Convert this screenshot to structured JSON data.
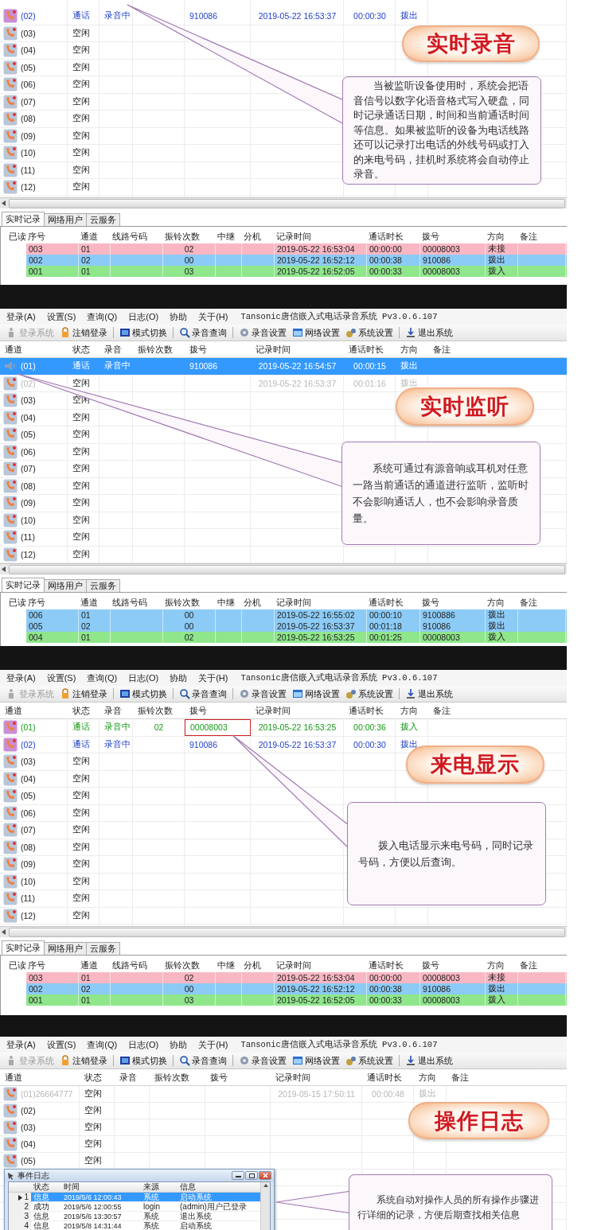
{
  "panels": [
    {
      "rows": [
        {
          "channel": "(02)",
          "in_call": true,
          "status": "通话",
          "recording": "录音中",
          "dial": "910086",
          "time": "2019-05-22 16:53:37",
          "duration": "00:00:30",
          "direction": "拨出",
          "color": "#1f3fc8",
          "selected": false
        },
        {
          "channel": "(03)",
          "in_call": false,
          "status": "空闲",
          "selected": false
        },
        {
          "channel": "(04)",
          "in_call": false,
          "status": "空闲",
          "selected": false
        },
        {
          "channel": "(05)",
          "in_call": false,
          "status": "空闲",
          "selected": false
        },
        {
          "channel": "(06)",
          "in_call": false,
          "status": "空闲",
          "selected": false
        },
        {
          "channel": "(07)",
          "in_call": false,
          "status": "空闲",
          "selected": false
        },
        {
          "channel": "(08)",
          "in_call": false,
          "status": "空闲",
          "selected": false
        },
        {
          "channel": "(09)",
          "in_call": false,
          "status": "空闲",
          "selected": false
        },
        {
          "channel": "(10)",
          "in_call": false,
          "status": "空闲",
          "selected": false
        },
        {
          "channel": "(11)",
          "in_call": false,
          "status": "空闲",
          "selected": false
        },
        {
          "channel": "(12)",
          "in_call": false,
          "status": "空闲",
          "selected": false
        }
      ],
      "badge": "实时录音",
      "callout": "当被监听设备使用时，系统会把语音信号以数字化语音格式写入硬盘，同时记录通话日期，时间和当前通话时间等信息。如果被监听的设备为电话线路还可以记录打出电话的外线号码或打入的来电号码，挂机时系统将会自动停止录音。",
      "bottom_tabs": [
        {
          "label": "实时记录",
          "selected": true
        },
        {
          "label": "网络用户",
          "selected": false
        },
        {
          "label": "云服务",
          "selected": false
        }
      ],
      "log": {
        "columns": [
          "已读",
          "序号",
          "通道",
          "线路号码",
          "振铃次数",
          "中继",
          "分机",
          "记录时间",
          "通话时长",
          "拨号",
          "方向",
          "备注"
        ],
        "rows": [
          {
            "seq": "003",
            "channel": "01",
            "rings": "02",
            "time": "2019-05-22 16:53:04",
            "duration": "00:00:00",
            "dial": "00008003",
            "direction": "未接",
            "color": "#f9b7c4"
          },
          {
            "seq": "002",
            "channel": "02",
            "rings": "00",
            "time": "2019-05-22 16:52:12",
            "duration": "00:00:38",
            "dial": "910086",
            "direction": "拨出",
            "color": "#8ccbf6"
          },
          {
            "seq": "001",
            "channel": "01",
            "rings": "03",
            "time": "2019-05-22 16:52:05",
            "duration": "00:00:33",
            "dial": "00008003",
            "direction": "拨入",
            "color": "#8fe68b"
          }
        ]
      }
    },
    {
      "menu": {
        "items": [
          "登录(A)",
          "设置(S)",
          "查询(Q)",
          "日志(O)",
          "协助",
          "关于(H)"
        ],
        "title": "Tansonic唐信嵌入式电话录音系统 Pv3.0.6.107"
      },
      "toolbar": [
        {
          "label": "登录系统",
          "disabled": true
        },
        {
          "label": "注销登录",
          "disabled": false
        },
        {
          "label": "模式切换",
          "disabled": false
        },
        {
          "label": "录音查询",
          "disabled": false
        },
        {
          "label": "录音设置",
          "disabled": false
        },
        {
          "label": "网络设置",
          "disabled": false
        },
        {
          "label": "系统设置",
          "disabled": false
        },
        {
          "label": "退出系统",
          "disabled": false
        }
      ],
      "columns": [
        "通道",
        "状态",
        "录音",
        "振铃次数",
        "拨号",
        "记录时间",
        "通话时长",
        "方向",
        "备注"
      ],
      "rows": [
        {
          "channel": "(01)",
          "in_call": true,
          "monitoring": true,
          "status": "通话",
          "recording": "录音中",
          "dial": "910086",
          "time": "2019-05-22 16:54:57",
          "duration": "00:00:15",
          "direction": "拨出",
          "selected": true
        },
        {
          "channel": "(02)",
          "in_call": false,
          "monitoring": false,
          "status": "空闲",
          "time": "2019-05-22 16:53:37",
          "duration": "00:01:16",
          "direction": "拨出",
          "color": "#b8b8b8",
          "selected": false
        },
        {
          "channel": "(03)",
          "in_call": false,
          "monitoring": false,
          "status": "空闲",
          "selected": false
        },
        {
          "channel": "(04)",
          "in_call": false,
          "monitoring": false,
          "status": "空闲",
          "selected": false
        },
        {
          "channel": "(05)",
          "in_call": false,
          "monitoring": false,
          "status": "空闲",
          "selected": false
        },
        {
          "channel": "(06)",
          "in_call": false,
          "monitoring": false,
          "status": "空闲",
          "selected": false
        },
        {
          "channel": "(07)",
          "in_call": false,
          "monitoring": false,
          "status": "空闲",
          "selected": false
        },
        {
          "channel": "(08)",
          "in_call": false,
          "monitoring": false,
          "status": "空闲",
          "selected": false
        },
        {
          "channel": "(09)",
          "in_call": false,
          "monitoring": false,
          "status": "空闲",
          "selected": false
        },
        {
          "channel": "(10)",
          "in_call": false,
          "monitoring": false,
          "status": "空闲",
          "selected": false
        },
        {
          "channel": "(11)",
          "in_call": false,
          "monitoring": false,
          "status": "空闲",
          "selected": false
        },
        {
          "channel": "(12)",
          "in_call": false,
          "monitoring": false,
          "status": "空闲",
          "selected": false
        }
      ],
      "badge": "实时监听",
      "callout": "系统可通过有源音响或耳机对任意一路当前通话的通道进行监听，监听时不会影响通话人，也不会影响录音质量。",
      "bottom_tabs": [
        {
          "label": "实时记录",
          "selected": true
        },
        {
          "label": "网络用户",
          "selected": false
        },
        {
          "label": "云服务",
          "selected": false
        }
      ],
      "log": {
        "columns": [
          "已读",
          "序号",
          "通道",
          "线路号码",
          "振铃次数",
          "中继",
          "分机",
          "记录时间",
          "通话时长",
          "拨号",
          "方向",
          "备注"
        ],
        "rows": [
          {
            "seq": "006",
            "channel": "01",
            "rings": "00",
            "time": "2019-05-22 16:55:02",
            "duration": "00:00:10",
            "dial": "9100886",
            "direction": "拨出",
            "color": "#8ccbf6"
          },
          {
            "seq": "005",
            "channel": "02",
            "rings": "00",
            "time": "2019-05-22 16:53:37",
            "duration": "00:01:18",
            "dial": "910086",
            "direction": "拨出",
            "color": "#8ccbf6"
          },
          {
            "seq": "004",
            "channel": "01",
            "rings": "02",
            "time": "2019-05-22 16:53:25",
            "duration": "00:01:25",
            "dial": "00008003",
            "direction": "拨入",
            "color": "#8fe68b"
          }
        ]
      }
    },
    {
      "menu": {
        "items": [
          "登录(A)",
          "设置(S)",
          "查询(Q)",
          "日志(O)",
          "协助",
          "关于(H)"
        ],
        "title": "Tansonic唐信嵌入式电话录音系统 Pv3.0.6.107"
      },
      "toolbar": [
        {
          "label": "登录系统",
          "disabled": true
        },
        {
          "label": "注销登录",
          "disabled": false
        },
        {
          "label": "模式切换",
          "disabled": false
        },
        {
          "label": "录音查询",
          "disabled": false
        },
        {
          "label": "录音设置",
          "disabled": false
        },
        {
          "label": "网络设置",
          "disabled": false
        },
        {
          "label": "系统设置",
          "disabled": false
        },
        {
          "label": "退出系统",
          "disabled": false
        }
      ],
      "columns": [
        "通道",
        "状态",
        "录音",
        "振铃次数",
        "拨号",
        "记录时间",
        "通话时长",
        "方向",
        "备注"
      ],
      "rows": [
        {
          "channel": "(01)",
          "in_call": true,
          "status": "通话",
          "recording": "录音中",
          "rings": "02",
          "dial": "00008003",
          "time": "2019-05-22 16:53:25",
          "duration": "00:00:36",
          "direction": "拨入",
          "color": "#179a17",
          "selected": false,
          "highlighted": true
        },
        {
          "channel": "(02)",
          "in_call": true,
          "status": "通话",
          "recording": "录音中",
          "dial": "910086",
          "time": "2019-05-22 16:53:37",
          "duration": "00:00:30",
          "direction": "拨出",
          "color": "#1f3fc8",
          "selected": false,
          "highlighted": false
        },
        {
          "channel": "(03)",
          "in_call": false,
          "status": "空闲",
          "selected": false,
          "highlighted": false
        },
        {
          "channel": "(04)",
          "in_call": false,
          "status": "空闲",
          "selected": false,
          "highlighted": false
        },
        {
          "channel": "(05)",
          "in_call": false,
          "status": "空闲",
          "selected": false,
          "highlighted": false
        },
        {
          "channel": "(06)",
          "in_call": false,
          "status": "空闲",
          "selected": false,
          "highlighted": false
        },
        {
          "channel": "(07)",
          "in_call": false,
          "status": "空闲",
          "selected": false,
          "highlighted": false
        },
        {
          "channel": "(08)",
          "in_call": false,
          "status": "空闲",
          "selected": false,
          "highlighted": false
        },
        {
          "channel": "(09)",
          "in_call": false,
          "status": "空闲",
          "selected": false,
          "highlighted": false
        },
        {
          "channel": "(10)",
          "in_call": false,
          "status": "空闲",
          "selected": false,
          "highlighted": false
        },
        {
          "channel": "(11)",
          "in_call": false,
          "status": "空闲",
          "selected": false,
          "highlighted": false
        },
        {
          "channel": "(12)",
          "in_call": false,
          "status": "空闲",
          "selected": false,
          "highlighted": false
        }
      ],
      "badge": "来电显示",
      "callout": "拨入电话显示来电号码，同时记录号码，方便以后查询。",
      "bottom_tabs": [
        {
          "label": "实时记录",
          "selected": true
        },
        {
          "label": "网络用户",
          "selected": false
        },
        {
          "label": "云服务",
          "selected": false
        }
      ],
      "log": {
        "columns": [
          "已读",
          "序号",
          "通道",
          "线路号码",
          "振铃次数",
          "中继",
          "分机",
          "记录时间",
          "通话时长",
          "拨号",
          "方向",
          "备注"
        ],
        "rows": [
          {
            "seq": "003",
            "channel": "01",
            "rings": "02",
            "time": "2019-05-22 16:53:04",
            "duration": "00:00:00",
            "dial": "00008003",
            "direction": "未接",
            "color": "#f9b7c4"
          },
          {
            "seq": "002",
            "channel": "02",
            "rings": "00",
            "time": "2019-05-22 16:52:12",
            "duration": "00:00:38",
            "dial": "910086",
            "direction": "拨出",
            "color": "#8ccbf6"
          },
          {
            "seq": "001",
            "channel": "01",
            "rings": "03",
            "time": "2019-05-22 16:52:05",
            "duration": "00:00:33",
            "dial": "00008003",
            "direction": "拨入",
            "color": "#8fe68b"
          }
        ]
      }
    },
    {
      "menu": {
        "items": [
          "登录(A)",
          "设置(S)",
          "查询(Q)",
          "日志(O)",
          "协助",
          "关于(H)"
        ],
        "title": "Tansonic唐信嵌入式电话录音系统 Pv3.0.6.107"
      },
      "toolbar": [
        {
          "label": "登录系统",
          "disabled": true
        },
        {
          "label": "注销登录",
          "disabled": false
        },
        {
          "label": "模式切换",
          "disabled": false
        },
        {
          "label": "录音查询",
          "disabled": false
        },
        {
          "label": "录音设置",
          "disabled": false
        },
        {
          "label": "网络设置",
          "disabled": false
        },
        {
          "label": "系统设置",
          "disabled": false
        },
        {
          "label": "退出系统",
          "disabled": false
        }
      ],
      "columns": [
        "通道",
        "状态",
        "录音",
        "振铃次数",
        "拨号",
        "记录时间",
        "通话时长",
        "方向",
        "备注"
      ],
      "rows": [
        {
          "channel": "(01)26664777",
          "in_call": false,
          "status": "空闲",
          "time": "2019-05-15 17:50:11",
          "duration": "00:00:48",
          "direction": "拨出",
          "color": "#b8b8b8",
          "selected": false
        },
        {
          "channel": "(02)",
          "in_call": false,
          "status": "空闲",
          "selected": false
        },
        {
          "channel": "(03)",
          "in_call": false,
          "status": "空闲",
          "selected": false
        },
        {
          "channel": "(04)",
          "in_call": false,
          "status": "空闲",
          "selected": false
        },
        {
          "channel": "(05)",
          "in_call": false,
          "status": "空闲",
          "selected": false
        }
      ],
      "badge": "操作日志",
      "callout": "系统自动对操作人员的所有操作步骤进行详细的记录，方便后期查找相关信息",
      "event_log": {
        "title": "事件日志",
        "columns": [
          "状态",
          "时间",
          "来源",
          "信息"
        ],
        "rows": [
          {
            "index": "1",
            "status": "信息",
            "time": "2019/5/6 12:00:43",
            "source": "系统",
            "info": "启动系统",
            "selected": true
          },
          {
            "index": "2",
            "status": "成功",
            "time": "2019/5/6 12:00:55",
            "source": "login",
            "info": "(admin)用户已登录",
            "selected": false
          },
          {
            "index": "3",
            "status": "信息",
            "time": "2019/5/6 13:30:57",
            "source": "系统",
            "info": "退出系统",
            "selected": false
          },
          {
            "index": "4",
            "status": "信息",
            "time": "2019/5/8 14:31:44",
            "source": "系统",
            "info": "启动系统",
            "selected": false
          }
        ]
      }
    }
  ]
}
